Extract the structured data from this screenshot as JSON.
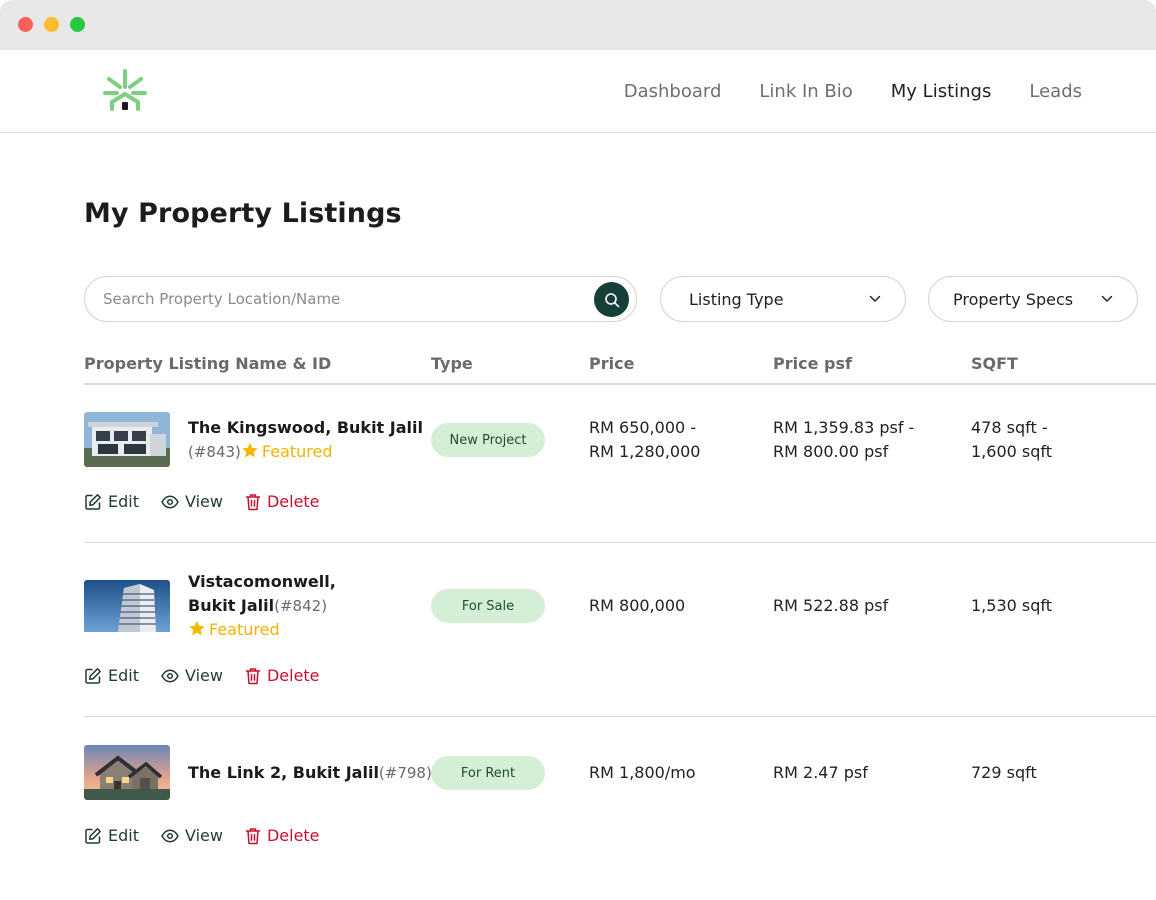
{
  "nav": {
    "items": [
      {
        "label": "Dashboard",
        "active": false
      },
      {
        "label": "Link In Bio",
        "active": false
      },
      {
        "label": "My Listings",
        "active": true
      },
      {
        "label": "Leads",
        "active": false
      }
    ]
  },
  "page": {
    "title": "My Property Listings"
  },
  "filters": {
    "search_placeholder": "Search Property Location/Name",
    "listing_type_label": "Listing Type",
    "property_specs_label": "Property Specs"
  },
  "table": {
    "headers": [
      "Property Listing Name & ID",
      "Type",
      "Price",
      "Price psf",
      "SQFT"
    ],
    "rows": [
      {
        "name_line1": "The Kingswood,  Bukit Jalil",
        "name_line2": "",
        "id": "(#843)",
        "featured": "Featured",
        "type": "New Project",
        "price_line1": "RM 650,000 -",
        "price_line2": "RM 1,280,000",
        "psf_line1": "RM 1,359.83 psf -",
        "psf_line2": "RM 800.00 psf",
        "sqft_line1": "478 sqft -",
        "sqft_line2": "1,600 sqft"
      },
      {
        "name_line1": "Vistacomonwell,",
        "name_line2": "Bukit Jalil",
        "id": "(#842)",
        "featured": "Featured",
        "type": "For Sale",
        "price": "RM 800,000",
        "psf": "RM 522.88 psf",
        "sqft": "1,530 sqft"
      },
      {
        "name_line1": "The Link 2,  Bukit Jalil",
        "id": "(#798)",
        "type": "For Rent",
        "price": "RM 1,800/mo",
        "psf": "RM 2.47 psf",
        "sqft": "729 sqft"
      }
    ]
  },
  "actions": {
    "edit": "Edit",
    "view": "View",
    "delete": "Delete"
  },
  "colors": {
    "brand_green": "#7ccf7e",
    "dark_teal": "#163f3a",
    "badge_bg": "#d4efd5",
    "featured": "#f2b300",
    "delete": "#c8102e"
  }
}
